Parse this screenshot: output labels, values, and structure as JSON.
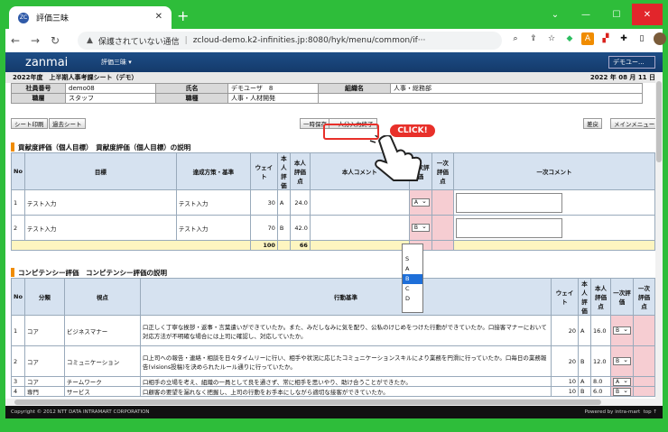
{
  "browser": {
    "tab_title": "評価三昧",
    "tab_favicon": "ZC",
    "url_warning": "保護されていない通信",
    "url": "zcloud-demo.k2-infinities.jp:8080/hyk/menu/common/if···"
  },
  "app": {
    "logo": "zanmai",
    "menu": "評価三昧 ▾",
    "demo_select": "デモユー..."
  },
  "sheet": {
    "title": "2022年度　上半期人事考課シート（デモ）",
    "date": "2022 年 08 月 11 日"
  },
  "info": {
    "emp_no_label": "社員番号",
    "emp_no": "demo08",
    "name_label": "氏名",
    "name": "デモユーザ　8",
    "org_label": "組織名",
    "org": "人事・総務部",
    "grade_label": "職層",
    "grade": "スタッフ",
    "job_label": "職種",
    "job": "人事・人材開発"
  },
  "buttons": {
    "print": "シート印刷",
    "past": "過去シート",
    "temp_save": "一時保存",
    "finish": "一人分入力終了",
    "back": "差戻",
    "main_menu": "メインメニュー"
  },
  "click_label": "CLICK!",
  "contrib": {
    "heading": "貢献度評価（個人目標）　貢献度評価（個人目標）の説明",
    "headers": [
      "No",
      "目標",
      "達成方策・基準",
      "ウェイト",
      "本人評価",
      "本人評価点",
      "本人コメント",
      "一次評価",
      "一次評価点",
      "一次コメント"
    ],
    "rows": [
      {
        "no": "1",
        "goal": "テスト入力",
        "method": "テスト入力",
        "weight": "30",
        "self": "A",
        "score": "24.0",
        "first": "A"
      },
      {
        "no": "2",
        "goal": "テスト入力",
        "method": "テスト入力",
        "weight": "70",
        "self": "B",
        "score": "42.0",
        "first": "B"
      }
    ],
    "total_weight": "100",
    "total_score": "66"
  },
  "dropdown": [
    "",
    "S",
    "A",
    "B",
    "C",
    "D"
  ],
  "comp": {
    "heading": "コンピテンシー評価　コンピテンシー評価の説明",
    "headers": [
      "No",
      "分類",
      "視点",
      "行動基準",
      "ウェイト",
      "本人評価",
      "本人評価点",
      "一次評価",
      "一次評価点"
    ],
    "rows": [
      {
        "no": "1",
        "cat": "コア",
        "view": "ビジネスマナー",
        "crit": "口正しく丁寧な挨拶・返事・言葉遣いができていたか。また、みだしなみに気を配り、公私のけじめをつけた行動ができていたか。口接客マナーにおいて対応方法が不明確な場合には上司に確認し、対応していたか。",
        "w": "20",
        "s": "A",
        "p": "16.0",
        "f": "B"
      },
      {
        "no": "2",
        "cat": "コア",
        "view": "コミュニケーション",
        "crit": "口上司への報告・連絡・相談を日々タイムリーに行い、相手や状況に応じたコミュニケーションスキルにより業務を円滑に行っていたか。口毎日の業務報告(visions投稿)を決められたルール通りに行っていたか。",
        "w": "20",
        "s": "B",
        "p": "12.0",
        "f": "B"
      },
      {
        "no": "3",
        "cat": "コア",
        "view": "チームワーク",
        "crit": "口相手の立場を考え、組織の一員として良を通さず、常に相手を思いやり、助け合うことができたか。",
        "w": "10",
        "s": "A",
        "p": "8.0",
        "f": "A"
      },
      {
        "no": "4",
        "cat": "専門",
        "view": "サービス",
        "crit": "口顧客の要望を漏れなく把握し、上司の行動をお手本にしながら適切な接客ができていたか。",
        "w": "10",
        "s": "B",
        "p": "6.0",
        "f": "B"
      }
    ]
  },
  "footer": {
    "copyright": "Copyright © 2012 NTT DATA INTRAMART CORPORATION",
    "powered": "Powered by intra-mart",
    "top": "top ↑"
  }
}
